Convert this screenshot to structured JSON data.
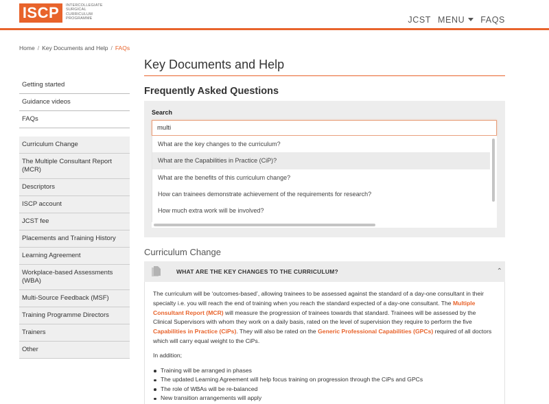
{
  "header": {
    "logo_text": "ISCP",
    "logo_subtitle": [
      "INTERCOLLEGIATE",
      "SURGICAL",
      "CURRICULUM",
      "PROGRAMME"
    ],
    "nav": {
      "jcst": "JCST",
      "menu": "MENU",
      "faqs": "FAQS"
    }
  },
  "breadcrumb": [
    "Home",
    "Key Documents and Help",
    "FAQs"
  ],
  "sidebar": {
    "top_items": [
      "Getting started",
      "Guidance videos",
      "FAQs"
    ],
    "sub_items": [
      "Curriculum Change",
      "The Multiple Consultant Report (MCR)",
      "Descriptors",
      "ISCP account",
      "JCST fee",
      "Placements and Training History",
      "Learning Agreement",
      "Workplace-based Assessments (WBA)",
      "Multi-Source Feedback (MSF)",
      "Training Programme Directors",
      "Trainers",
      "Other"
    ]
  },
  "main": {
    "title": "Key Documents and Help",
    "subtitle": "Frequently Asked Questions"
  },
  "search": {
    "label": "Search",
    "value": "multi",
    "suggestions": [
      "What are the key changes to the curriculum?",
      "What are the Capabilities in Practice (CiP)?",
      "What are the benefits of this curriculum change?",
      "How can trainees demonstrate achievement of the requirements for research?",
      "How much extra work will be involved?"
    ],
    "highlighted_index": 1
  },
  "section": {
    "heading": "Curriculum Change",
    "accordion_title": "WHAT ARE THE KEY CHANGES TO THE CURRICULUM?",
    "accordion_icon": "document-icon",
    "body": {
      "p1_a": "The curriculum will be ‘outcomes-based’, allowing trainees to be assessed against the standard of a day-one consultant in their specialty i.e. you will reach the end of training when you reach the standard expected of a day-one consultant. The ",
      "link_mcr": "Multiple Consultant Report (MCR)",
      "p1_b": " will measure the progression of trainees towards that standard. Trainees will be assessed by the Clinical Supervisors with whom they work on a daily basis, rated on the level of supervision they require to perform the five ",
      "link_cips": "Capabilities in Practice (CiPs)",
      "p1_c": ". They will also be rated on the ",
      "link_gpcs": "Generic Professional Capabilities (GPCs)",
      "p1_d": " required of all doctors which will carry equal weight to the CiPs.",
      "p2": "In addition;",
      "bullets": [
        "Training will be arranged in phases",
        "The updated Learning Agreement will help focus training on progression through the CiPs and GPCs",
        "The role of WBAs will be re-balanced",
        "New transition arrangements will apply"
      ]
    }
  },
  "colors": {
    "accent": "#e8632b",
    "panel": "#ededed"
  }
}
